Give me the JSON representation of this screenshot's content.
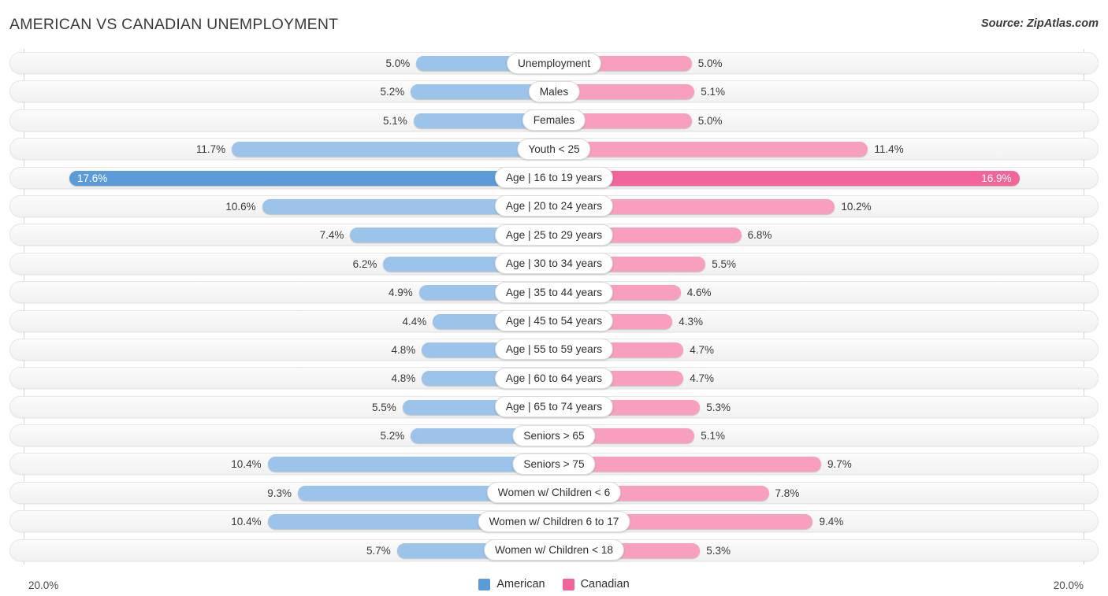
{
  "header": {
    "title": "AMERICAN VS CANADIAN UNEMPLOYMENT",
    "source": "Source: ZipAtlas.com"
  },
  "footer": {
    "tick_left": "20.0%",
    "tick_right": "20.0%",
    "legend": [
      {
        "label": "American",
        "color": "#5b9bd8"
      },
      {
        "label": "Canadian",
        "color": "#f2649a"
      }
    ]
  },
  "colors": {
    "american": "#9cc3ea",
    "american_highlight": "#5b9bd8",
    "canadian": "#f89fc0",
    "canadian_highlight": "#f2649a",
    "track": "#f6f6f6",
    "text": "#3a3a3a"
  },
  "chart_data": {
    "type": "bar",
    "title": "AMERICAN VS CANADIAN UNEMPLOYMENT",
    "subtype": "diverging-bidirectional",
    "xlabel": "",
    "ylabel": "",
    "xlim": [
      0,
      20.0
    ],
    "axis_max_label": "20.0%",
    "grid": false,
    "legend_position": "bottom-center",
    "categories": [
      "Unemployment",
      "Males",
      "Females",
      "Youth < 25",
      "Age | 16 to 19 years",
      "Age | 20 to 24 years",
      "Age | 25 to 29 years",
      "Age | 30 to 34 years",
      "Age | 35 to 44 years",
      "Age | 45 to 54 years",
      "Age | 55 to 59 years",
      "Age | 60 to 64 years",
      "Age | 65 to 74 years",
      "Seniors > 65",
      "Seniors > 75",
      "Women w/ Children < 6",
      "Women w/ Children 6 to 17",
      "Women w/ Children < 18"
    ],
    "series": [
      {
        "name": "American",
        "side": "left",
        "color": "#9cc3ea",
        "values": [
          5.0,
          5.2,
          5.1,
          11.7,
          17.6,
          10.6,
          7.4,
          6.2,
          4.9,
          4.4,
          4.8,
          4.8,
          5.5,
          5.2,
          10.4,
          9.3,
          10.4,
          5.7
        ],
        "labels": [
          "5.0%",
          "5.2%",
          "5.1%",
          "11.7%",
          "17.6%",
          "10.6%",
          "7.4%",
          "6.2%",
          "4.9%",
          "4.4%",
          "4.8%",
          "4.8%",
          "5.5%",
          "5.2%",
          "10.4%",
          "9.3%",
          "10.4%",
          "5.7%"
        ]
      },
      {
        "name": "Canadian",
        "side": "right",
        "color": "#f89fc0",
        "values": [
          5.0,
          5.1,
          5.0,
          11.4,
          16.9,
          10.2,
          6.8,
          5.5,
          4.6,
          4.3,
          4.7,
          4.7,
          5.3,
          5.1,
          9.7,
          7.8,
          9.4,
          5.3
        ],
        "labels": [
          "5.0%",
          "5.1%",
          "5.0%",
          "11.4%",
          "16.9%",
          "10.2%",
          "6.8%",
          "5.5%",
          "4.6%",
          "4.3%",
          "4.7%",
          "4.7%",
          "5.3%",
          "5.1%",
          "9.7%",
          "7.8%",
          "9.4%",
          "5.3%"
        ]
      }
    ],
    "highlighted_row_index": 4
  }
}
